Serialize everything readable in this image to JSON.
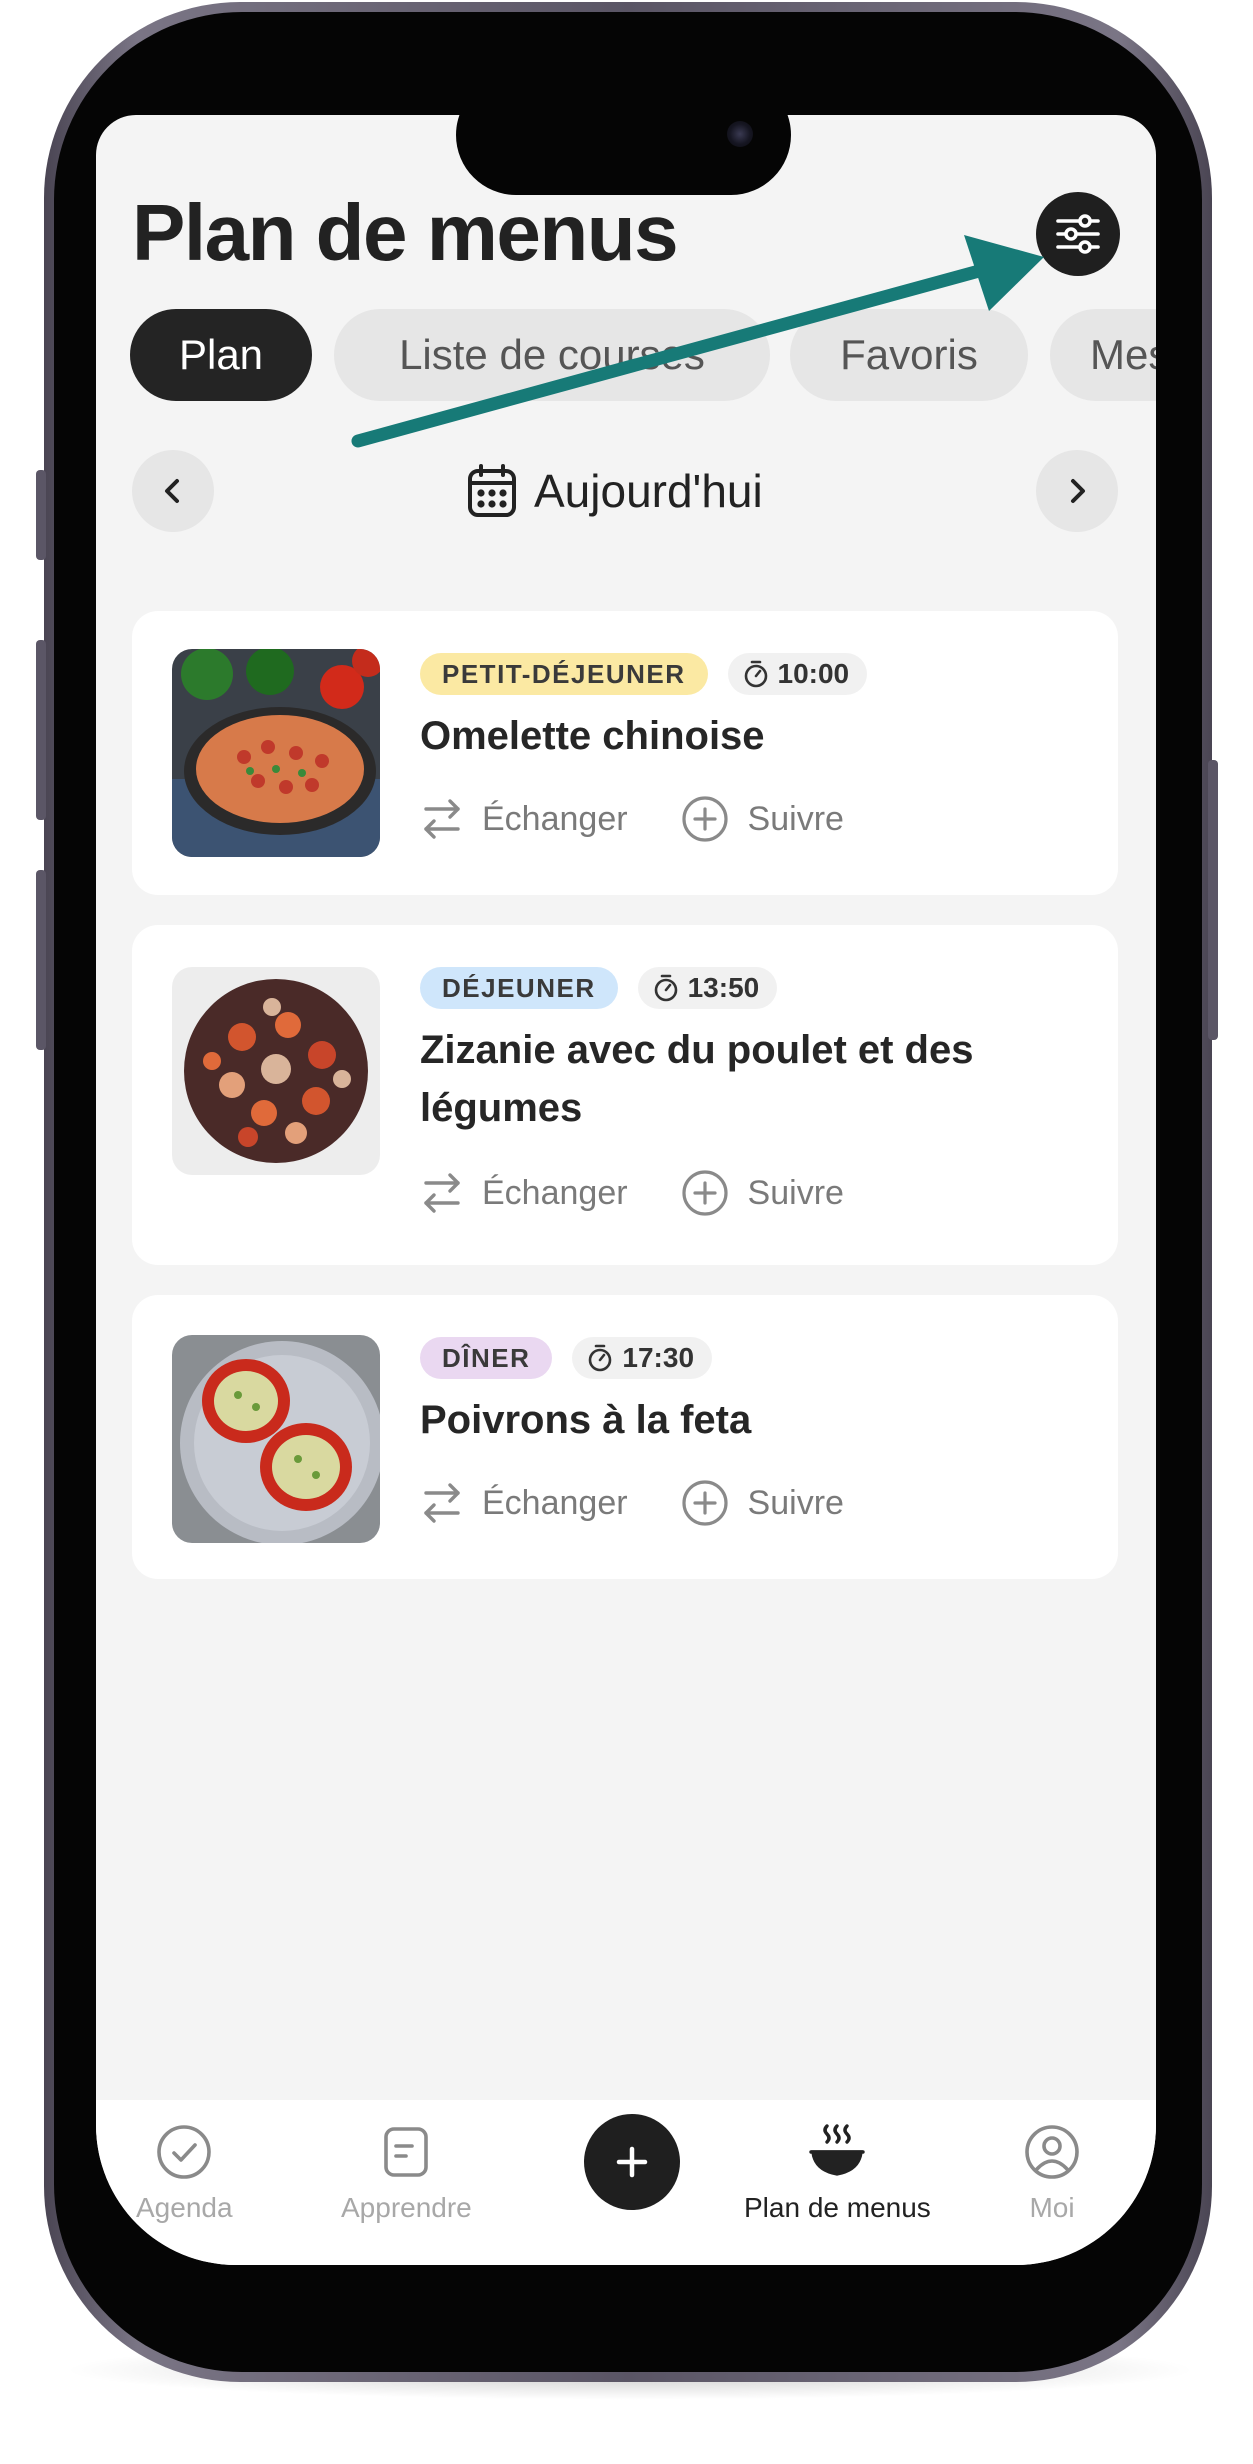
{
  "header": {
    "title": "Plan de menus"
  },
  "tabs": [
    {
      "label": "Plan",
      "active": true
    },
    {
      "label": "Liste de courses",
      "active": false
    },
    {
      "label": "Favoris",
      "active": false
    },
    {
      "label": "Mes",
      "active": false
    }
  ],
  "date_nav": {
    "label": "Aujourd'hui"
  },
  "meals": [
    {
      "tag": "PETIT-DÉJEUNER",
      "tag_color": "#fbe9a3",
      "time": "10:00",
      "title": "Omelette chinoise",
      "swap_label": "Échanger",
      "follow_label": "Suivre"
    },
    {
      "tag": "DÉJEUNER",
      "tag_color": "#cfe6fb",
      "time": "13:50",
      "title": "Zizanie avec du poulet et des légumes",
      "swap_label": "Échanger",
      "follow_label": "Suivre"
    },
    {
      "tag": "DÎNER",
      "tag_color": "#ead8f1",
      "time": "17:30",
      "title": "Poivrons à la feta",
      "swap_label": "Échanger",
      "follow_label": "Suivre"
    }
  ],
  "bottom_nav": [
    {
      "label": "Agenda",
      "icon": "check-circle-icon",
      "active": false
    },
    {
      "label": "Apprendre",
      "icon": "document-icon",
      "active": false
    },
    {
      "label": "",
      "icon": "plus-icon",
      "active": false
    },
    {
      "label": "Plan de menus",
      "icon": "bowl-icon",
      "active": true
    },
    {
      "label": "Moi",
      "icon": "user-icon",
      "active": false
    }
  ],
  "colors": {
    "annotation_arrow": "#177a77",
    "active_tab": "#242424",
    "background": "#f4f4f4"
  }
}
